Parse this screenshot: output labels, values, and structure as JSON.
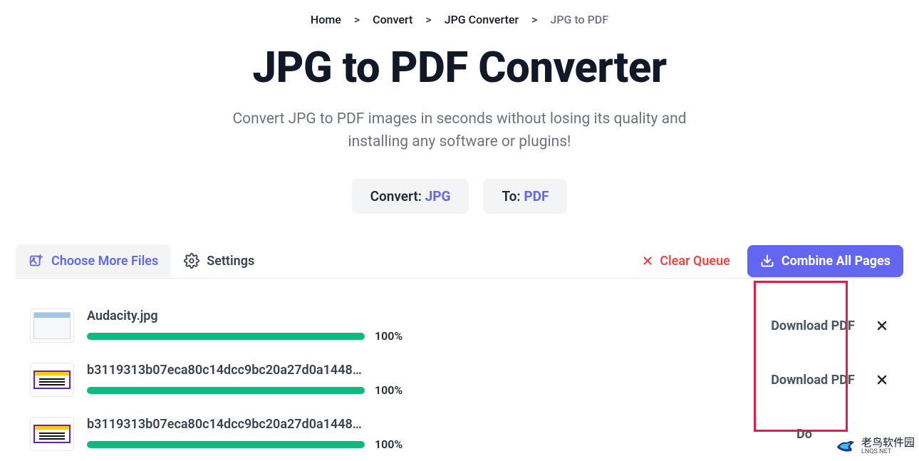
{
  "breadcrumb": {
    "items": [
      "Home",
      "Convert",
      "JPG Converter"
    ],
    "current": "JPG to PDF"
  },
  "title": "JPG to PDF Converter",
  "subtitle_line1": "Convert JPG to PDF images in seconds without losing its quality and",
  "subtitle_line2": "installing any software or plugins!",
  "convert_pill": {
    "label": "Convert:",
    "value": "JPG"
  },
  "to_pill": {
    "label": "To:",
    "value": "PDF"
  },
  "tabs": {
    "choose": "Choose More Files",
    "settings": "Settings"
  },
  "actions": {
    "clear": "Clear Queue",
    "combine": "Combine All Pages"
  },
  "files": [
    {
      "name": "Audacity.jpg",
      "progress": "100%",
      "download": "Download PDF"
    },
    {
      "name": "b3119313b07eca80c14dcc9bc20a27d0a144833...",
      "progress": "100%",
      "download": "Download PDF"
    },
    {
      "name": "b3119313b07eca80c14dcc9bc20a27d0a144833...",
      "progress": "100%",
      "download": "Do"
    }
  ],
  "watermark": {
    "text": "老鸟软件园",
    "sub": "LNQS.NET"
  }
}
